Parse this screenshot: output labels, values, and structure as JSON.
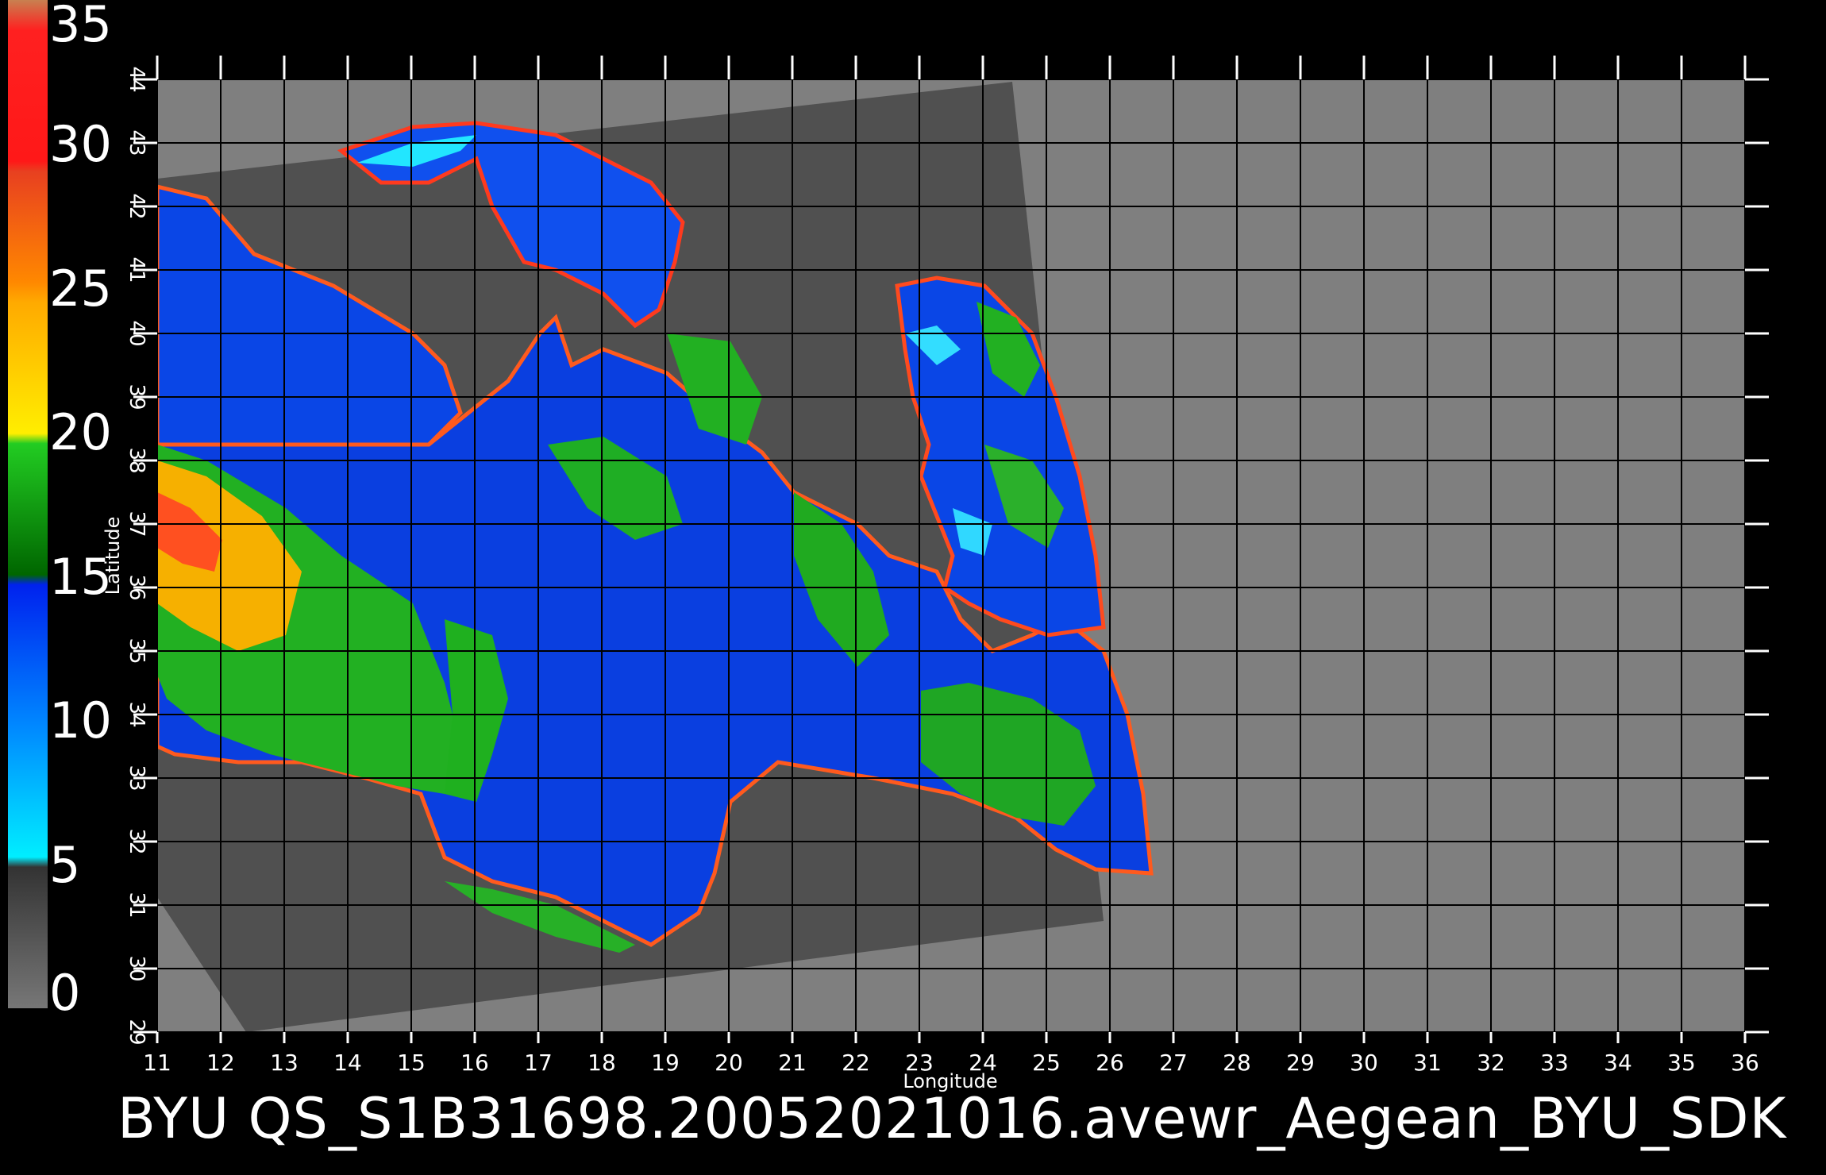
{
  "map": {
    "x_axis_title": "Longitude",
    "y_axis_title": "Latitude",
    "lon_ticks": [
      11,
      12,
      13,
      14,
      15,
      16,
      17,
      18,
      19,
      20,
      21,
      22,
      23,
      24,
      25,
      26,
      27,
      28,
      29,
      30,
      31,
      32,
      33,
      34,
      35,
      36
    ],
    "lat_ticks": [
      29,
      30,
      31,
      32,
      33,
      34,
      35,
      36,
      37,
      38,
      39,
      40,
      41,
      42,
      43,
      44
    ],
    "lon_range": [
      11,
      36
    ],
    "lat_range": [
      29,
      44
    ],
    "grid": true,
    "background_color": "#7f7f7f",
    "swath_color": "#505050"
  },
  "colorbar": {
    "ticks": [
      "35",
      "30",
      "25",
      "20",
      "15",
      "10",
      "5",
      "0"
    ],
    "range": [
      0,
      35
    ],
    "colors": [
      "#c88050",
      "#ff2020",
      "#e84020",
      "#ff8800",
      "#ffdd00",
      "#22cc22",
      "#006600",
      "#0022ee",
      "#0088ff",
      "#00eeff",
      "#333333",
      "#777777"
    ]
  },
  "footer": {
    "text": "BYU  QS_S1B31698.2005202101​6.avewr_Aegean_BYU_SDK"
  }
}
